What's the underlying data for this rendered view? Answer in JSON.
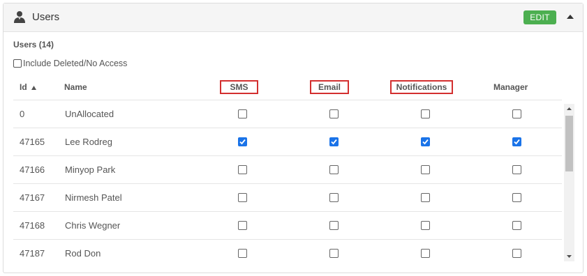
{
  "panel": {
    "title": "Users",
    "edit_label": "EDIT"
  },
  "users_count": "Users (14)",
  "include_label": "Include Deleted/No Access",
  "columns": {
    "id": "Id",
    "name": "Name",
    "sms": "SMS",
    "email": "Email",
    "notifications": "Notifications",
    "manager": "Manager"
  },
  "rows": [
    {
      "id": "0",
      "name": "UnAllocated",
      "sms": false,
      "email": false,
      "notifications": false,
      "manager": false
    },
    {
      "id": "47165",
      "name": "Lee Rodreg",
      "sms": true,
      "email": true,
      "notifications": true,
      "manager": true
    },
    {
      "id": "47166",
      "name": "Minyop Park",
      "sms": false,
      "email": false,
      "notifications": false,
      "manager": false
    },
    {
      "id": "47167",
      "name": "Nirmesh Patel",
      "sms": false,
      "email": false,
      "notifications": false,
      "manager": false
    },
    {
      "id": "47168",
      "name": "Chris Wegner",
      "sms": false,
      "email": false,
      "notifications": false,
      "manager": false
    },
    {
      "id": "47187",
      "name": "Rod Don",
      "sms": false,
      "email": false,
      "notifications": false,
      "manager": false
    }
  ],
  "colors": {
    "accent_green": "#4caf50",
    "checkbox_blue": "#1a73e8",
    "highlight_red": "#d32f2f"
  },
  "icons": {
    "header": "user-icon",
    "collapse": "chevron-up-icon",
    "sort": "sort-asc-icon"
  }
}
